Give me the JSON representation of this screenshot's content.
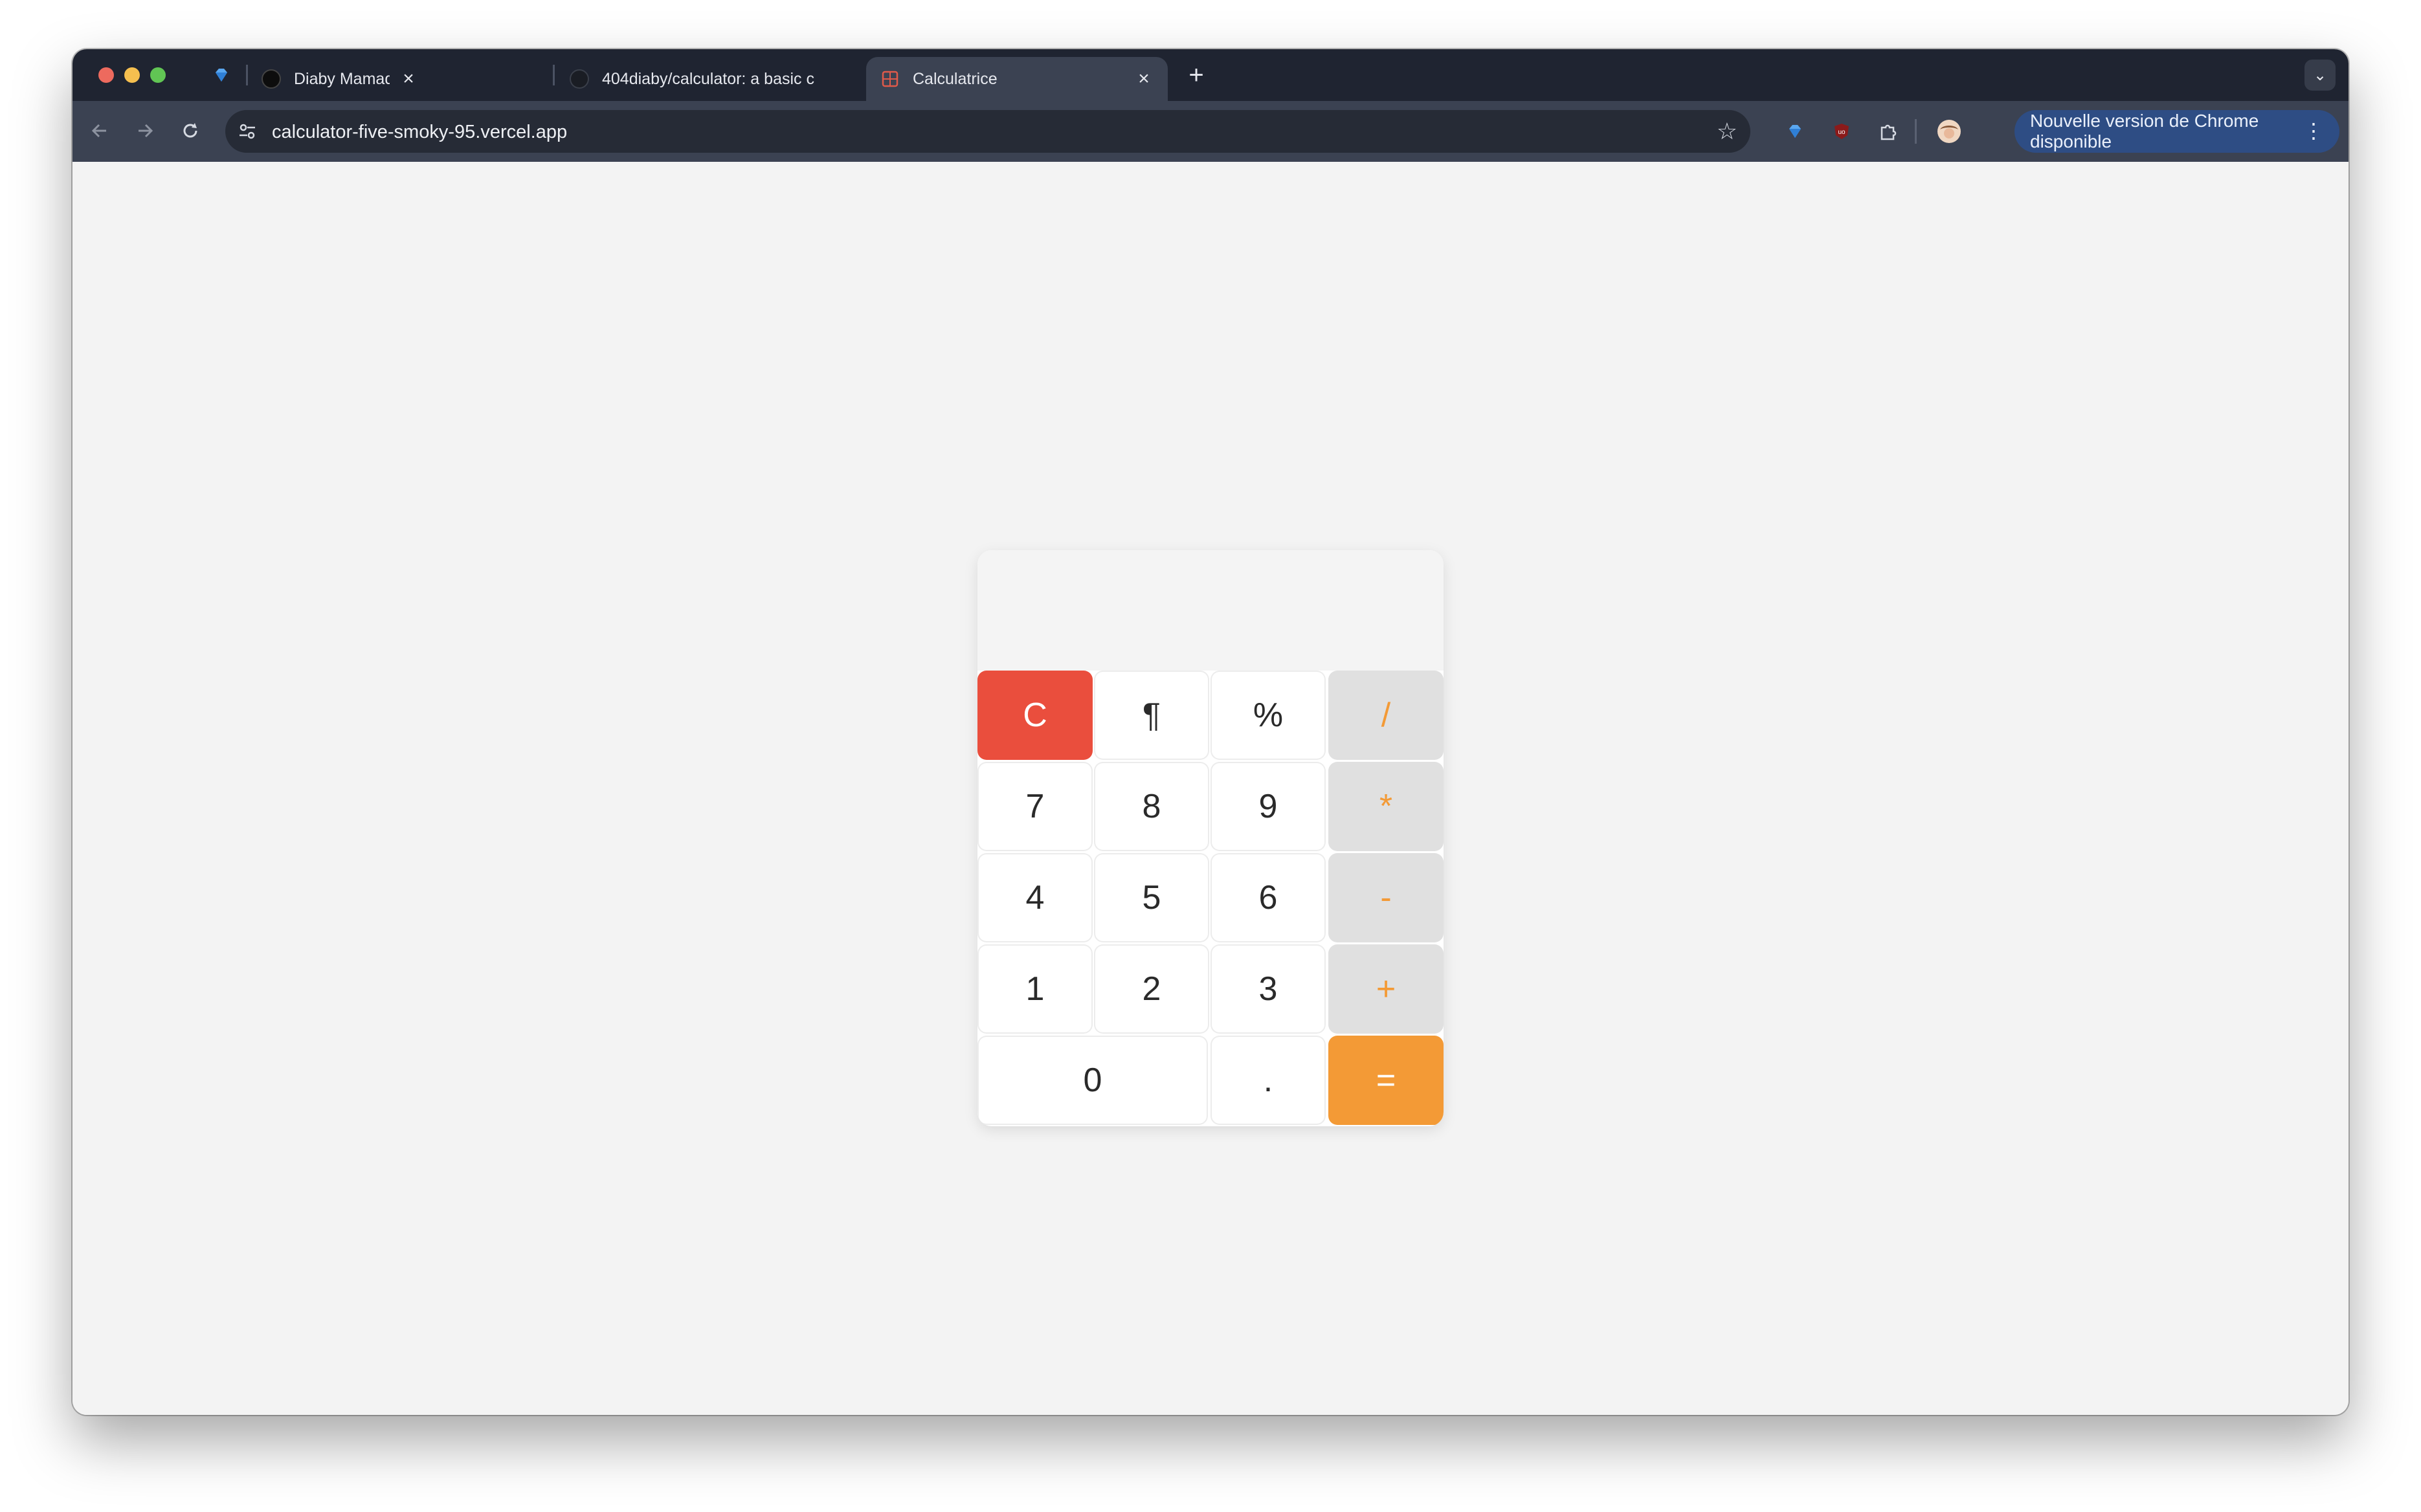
{
  "browser": {
    "tabs": [
      {
        "title": "",
        "favicon": "gem-icon",
        "pinned": true
      },
      {
        "title": "Diaby Mamadou - Portfolio",
        "favicon": "portfolio-icon"
      },
      {
        "title": "404diaby/calculator: a basic c",
        "favicon": "github-icon"
      },
      {
        "title": "Calculatrice",
        "favicon": "calculator-icon",
        "active": true
      }
    ],
    "close_glyph": "×",
    "new_tab_glyph": "+",
    "tab_search_glyph": "⌄",
    "address": "calculator-five-smoky-95.vercel.app",
    "update_label": "Nouvelle version de Chrome disponible",
    "menu_glyph": "⋮"
  },
  "calculator": {
    "display": "",
    "keys": {
      "clear": "C",
      "pilcrow": "¶",
      "percent": "%",
      "divide": "/",
      "seven": "7",
      "eight": "8",
      "nine": "9",
      "multiply": "*",
      "four": "4",
      "five": "5",
      "six": "6",
      "minus": "-",
      "one": "1",
      "two": "2",
      "three": "3",
      "plus": "+",
      "zero": "0",
      "dot": ".",
      "equals": "="
    }
  },
  "colors": {
    "clear_red": "#ea4e3d",
    "accent_orange": "#f39a36",
    "operator_gray": "#e0e0e0",
    "titlebar": "#1f2431",
    "toolbar": "#3b4252"
  }
}
